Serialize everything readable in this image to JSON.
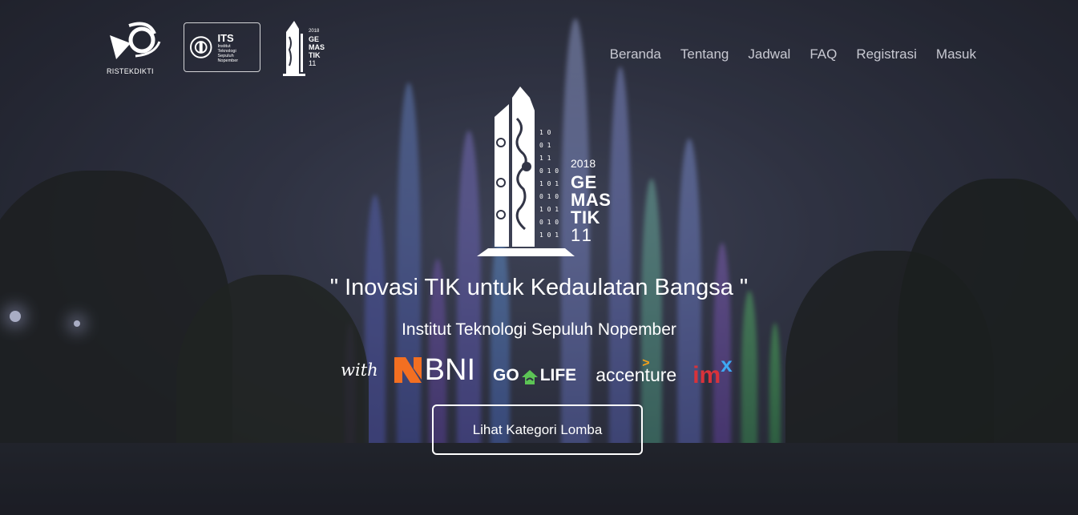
{
  "header": {
    "logos": [
      {
        "label": "RISTEKDIKTI"
      },
      {
        "title": "ITS",
        "subtitle_lines": [
          "Institut",
          "Teknologi",
          "Sepuluh Nopember"
        ]
      },
      {
        "year": "2018",
        "lines": [
          "GE",
          "MAS",
          "TIK",
          "11"
        ]
      }
    ]
  },
  "nav": {
    "items": [
      "Beranda",
      "Tentang",
      "Jadwal",
      "FAQ",
      "Registrasi",
      "Masuk"
    ]
  },
  "hero": {
    "logo": {
      "year": "2018",
      "lines": [
        "GE",
        "MAS",
        "TIK"
      ],
      "number": "11"
    },
    "tagline": "\" Inovasi TIK untuk Kedaulatan Bangsa \"",
    "institute": "Institut Teknologi Sepuluh Nopember",
    "sponsors": {
      "with_label": "with",
      "bni": "BNI",
      "golife_left": "GO",
      "golife_right": "LIFE",
      "accenture": "accenture",
      "accenture_mark": ">",
      "imx_main": "im",
      "imx_sup": "x"
    },
    "cta_label": "Lihat Kategori Lomba"
  },
  "colors": {
    "accent_orange": "#f36f21",
    "golife_green": "#5cc455",
    "accenture_orange": "#f6a01a",
    "imx_red": "#d9323a",
    "imx_blue": "#3da9f5",
    "nav_text": "#c8c9d2"
  }
}
